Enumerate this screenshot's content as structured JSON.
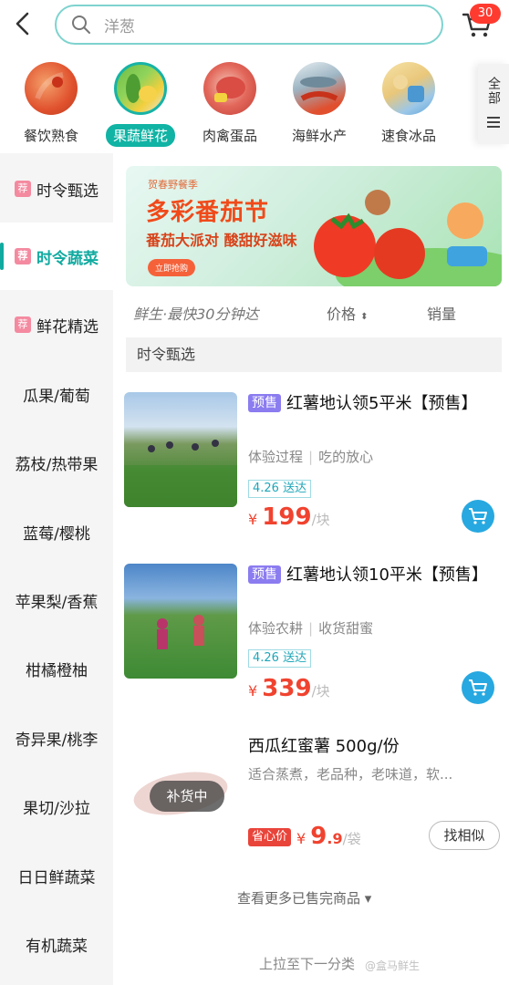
{
  "header": {
    "search_placeholder": "洋葱",
    "cart_badge": "30"
  },
  "categories": [
    {
      "label": "餐饮熟食",
      "icon": "crayfish-icon"
    },
    {
      "label": "果蔬鲜花",
      "icon": "vegetables-icon",
      "active": true
    },
    {
      "label": "肉禽蛋品",
      "icon": "meat-icon"
    },
    {
      "label": "海鲜水产",
      "icon": "seafood-icon"
    },
    {
      "label": "速食冰品",
      "icon": "frozen-food-icon"
    }
  ],
  "cat_all_label": "全部",
  "sidebar": [
    {
      "label": "时令甄选",
      "tag": "荐"
    },
    {
      "label": "时令蔬菜",
      "tag": "荐",
      "active": true
    },
    {
      "label": "鲜花精选",
      "tag": "荐"
    },
    {
      "label": "瓜果/葡萄"
    },
    {
      "label": "荔枝/热带果"
    },
    {
      "label": "蓝莓/樱桃"
    },
    {
      "label": "苹果梨/香蕉"
    },
    {
      "label": "柑橘橙柚"
    },
    {
      "label": "奇异果/桃李"
    },
    {
      "label": "果切/沙拉"
    },
    {
      "label": "日日鲜蔬菜"
    },
    {
      "label": "有机蔬菜"
    }
  ],
  "banner": {
    "small": "贺春野餐季",
    "title": "多彩番茄节",
    "sub": "番茄大派对 酸甜好滋味",
    "button": "立即抢购"
  },
  "sortbar": {
    "label_a": "鲜生·最快30分钟达",
    "price": "价格",
    "sales": "销量"
  },
  "section_header": "时令甄选",
  "products": [
    {
      "tag": "预售",
      "title": "红薯地认领5平米【预售】",
      "desc1": "体验过程",
      "desc2": "吃的放心",
      "delivery": "4.26 送达",
      "currency": "¥",
      "price": "199",
      "unit": "/块"
    },
    {
      "tag": "预售",
      "title": "红薯地认领10平米【预售】",
      "desc1": "体验农耕",
      "desc2": "收货甜蜜",
      "delivery": "4.26 送达",
      "currency": "¥",
      "price": "339",
      "unit": "/块"
    },
    {
      "title": "西瓜红蜜薯 500g/份",
      "desc": "适合蒸煮，老品种，老味道，软...",
      "sale_tag": "省心价",
      "currency": "¥",
      "price": "9",
      "price_dec": ".9",
      "unit": "/袋",
      "restock": "补货中",
      "similar": "找相似"
    }
  ],
  "more_sold": "查看更多已售完商品 ▾",
  "pull_next": "上拉至下一分类",
  "watermark": "@盒马鲜生"
}
